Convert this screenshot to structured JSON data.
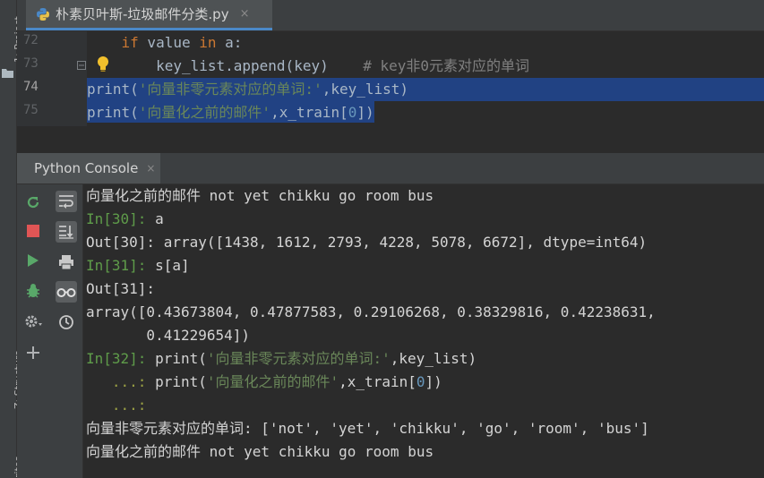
{
  "editor": {
    "tab_title": "朴素贝叶斯-垃圾邮件分类.py",
    "close_glyph": "×",
    "lines": [
      {
        "num": "72",
        "tokens": [
          [
            "    ",
            "id"
          ],
          [
            "if",
            "kw"
          ],
          [
            " value ",
            "id"
          ],
          [
            "in",
            "kw"
          ],
          [
            " a:",
            "id"
          ]
        ]
      },
      {
        "num": "73",
        "tokens": [
          [
            "        key_list.append(key)    ",
            "id"
          ],
          [
            "# key非0元素对应的单词",
            "cmt"
          ]
        ]
      },
      {
        "num": "74",
        "tokens": [
          [
            "print(",
            "id"
          ],
          [
            "'向量非零元素对应的单词:'",
            "str"
          ],
          [
            ",key_list)",
            "id"
          ]
        ]
      },
      {
        "num": "75",
        "tokens": [
          [
            "print(",
            "id"
          ],
          [
            "'向量化之前的邮件'",
            "str"
          ],
          [
            ",x_train[",
            "id"
          ],
          [
            "0",
            "num"
          ],
          [
            "])",
            "id"
          ]
        ]
      }
    ]
  },
  "side_tabs": {
    "project": "1: Project",
    "structure": "Z: Structure",
    "favorites": "rites"
  },
  "console": {
    "tab_label": "Python Console",
    "close_glyph": "×",
    "lines": [
      [
        [
          "向量化之前的邮件 not yet chikku go room bus",
          ""
        ]
      ],
      [
        [
          "In[30]:",
          "prompt"
        ],
        [
          " a",
          ""
        ]
      ],
      [
        [
          "Out[30]: array([1438, 1612, 2793, 4228, 5078, 6672], dtype=int64)",
          ""
        ]
      ],
      [
        [
          "In[31]:",
          "prompt"
        ],
        [
          " s[a]",
          ""
        ]
      ],
      [
        [
          "Out[31]:",
          ""
        ]
      ],
      [
        [
          "array([0.43673804, 0.47877583, 0.29106268, 0.38329816, 0.42238631,",
          ""
        ]
      ],
      [
        [
          "       0.41229654])",
          ""
        ]
      ],
      [
        [
          "In[32]:",
          "prompt"
        ],
        [
          " print(",
          ""
        ],
        [
          "'向量非零元素对应的单词:'",
          "str"
        ],
        [
          ",key_list)",
          ""
        ]
      ],
      [
        [
          "   ...:",
          "cont"
        ],
        [
          " print(",
          ""
        ],
        [
          "'向量化之前的邮件'",
          "str"
        ],
        [
          ",x_train[",
          ""
        ],
        [
          "0",
          "num"
        ],
        [
          "])",
          ""
        ]
      ],
      [
        [
          "   ...:",
          "cont"
        ]
      ],
      [
        [
          "向量非零元素对应的单词: ['not', 'yet', 'chikku', 'go', 'room', 'bus']",
          ""
        ]
      ],
      [
        [
          "向量化之前的邮件 not yet chikku go room bus",
          ""
        ]
      ]
    ]
  },
  "toolbar_icons": [
    "rerun-icon",
    "stop-icon",
    "run-icon",
    "debug-icon",
    "settings-icon",
    "add-icon"
  ],
  "toolbar2_icons": [
    "soft-wrap-icon",
    "scroll-to-end-icon",
    "print-icon",
    "variables-icon",
    "history-icon"
  ],
  "colors": {
    "keyword": "#cc7832",
    "string": "#6a8759",
    "comment": "#808080",
    "number": "#6897bb",
    "prompt": "#5f9c4a",
    "selection": "#214283"
  }
}
